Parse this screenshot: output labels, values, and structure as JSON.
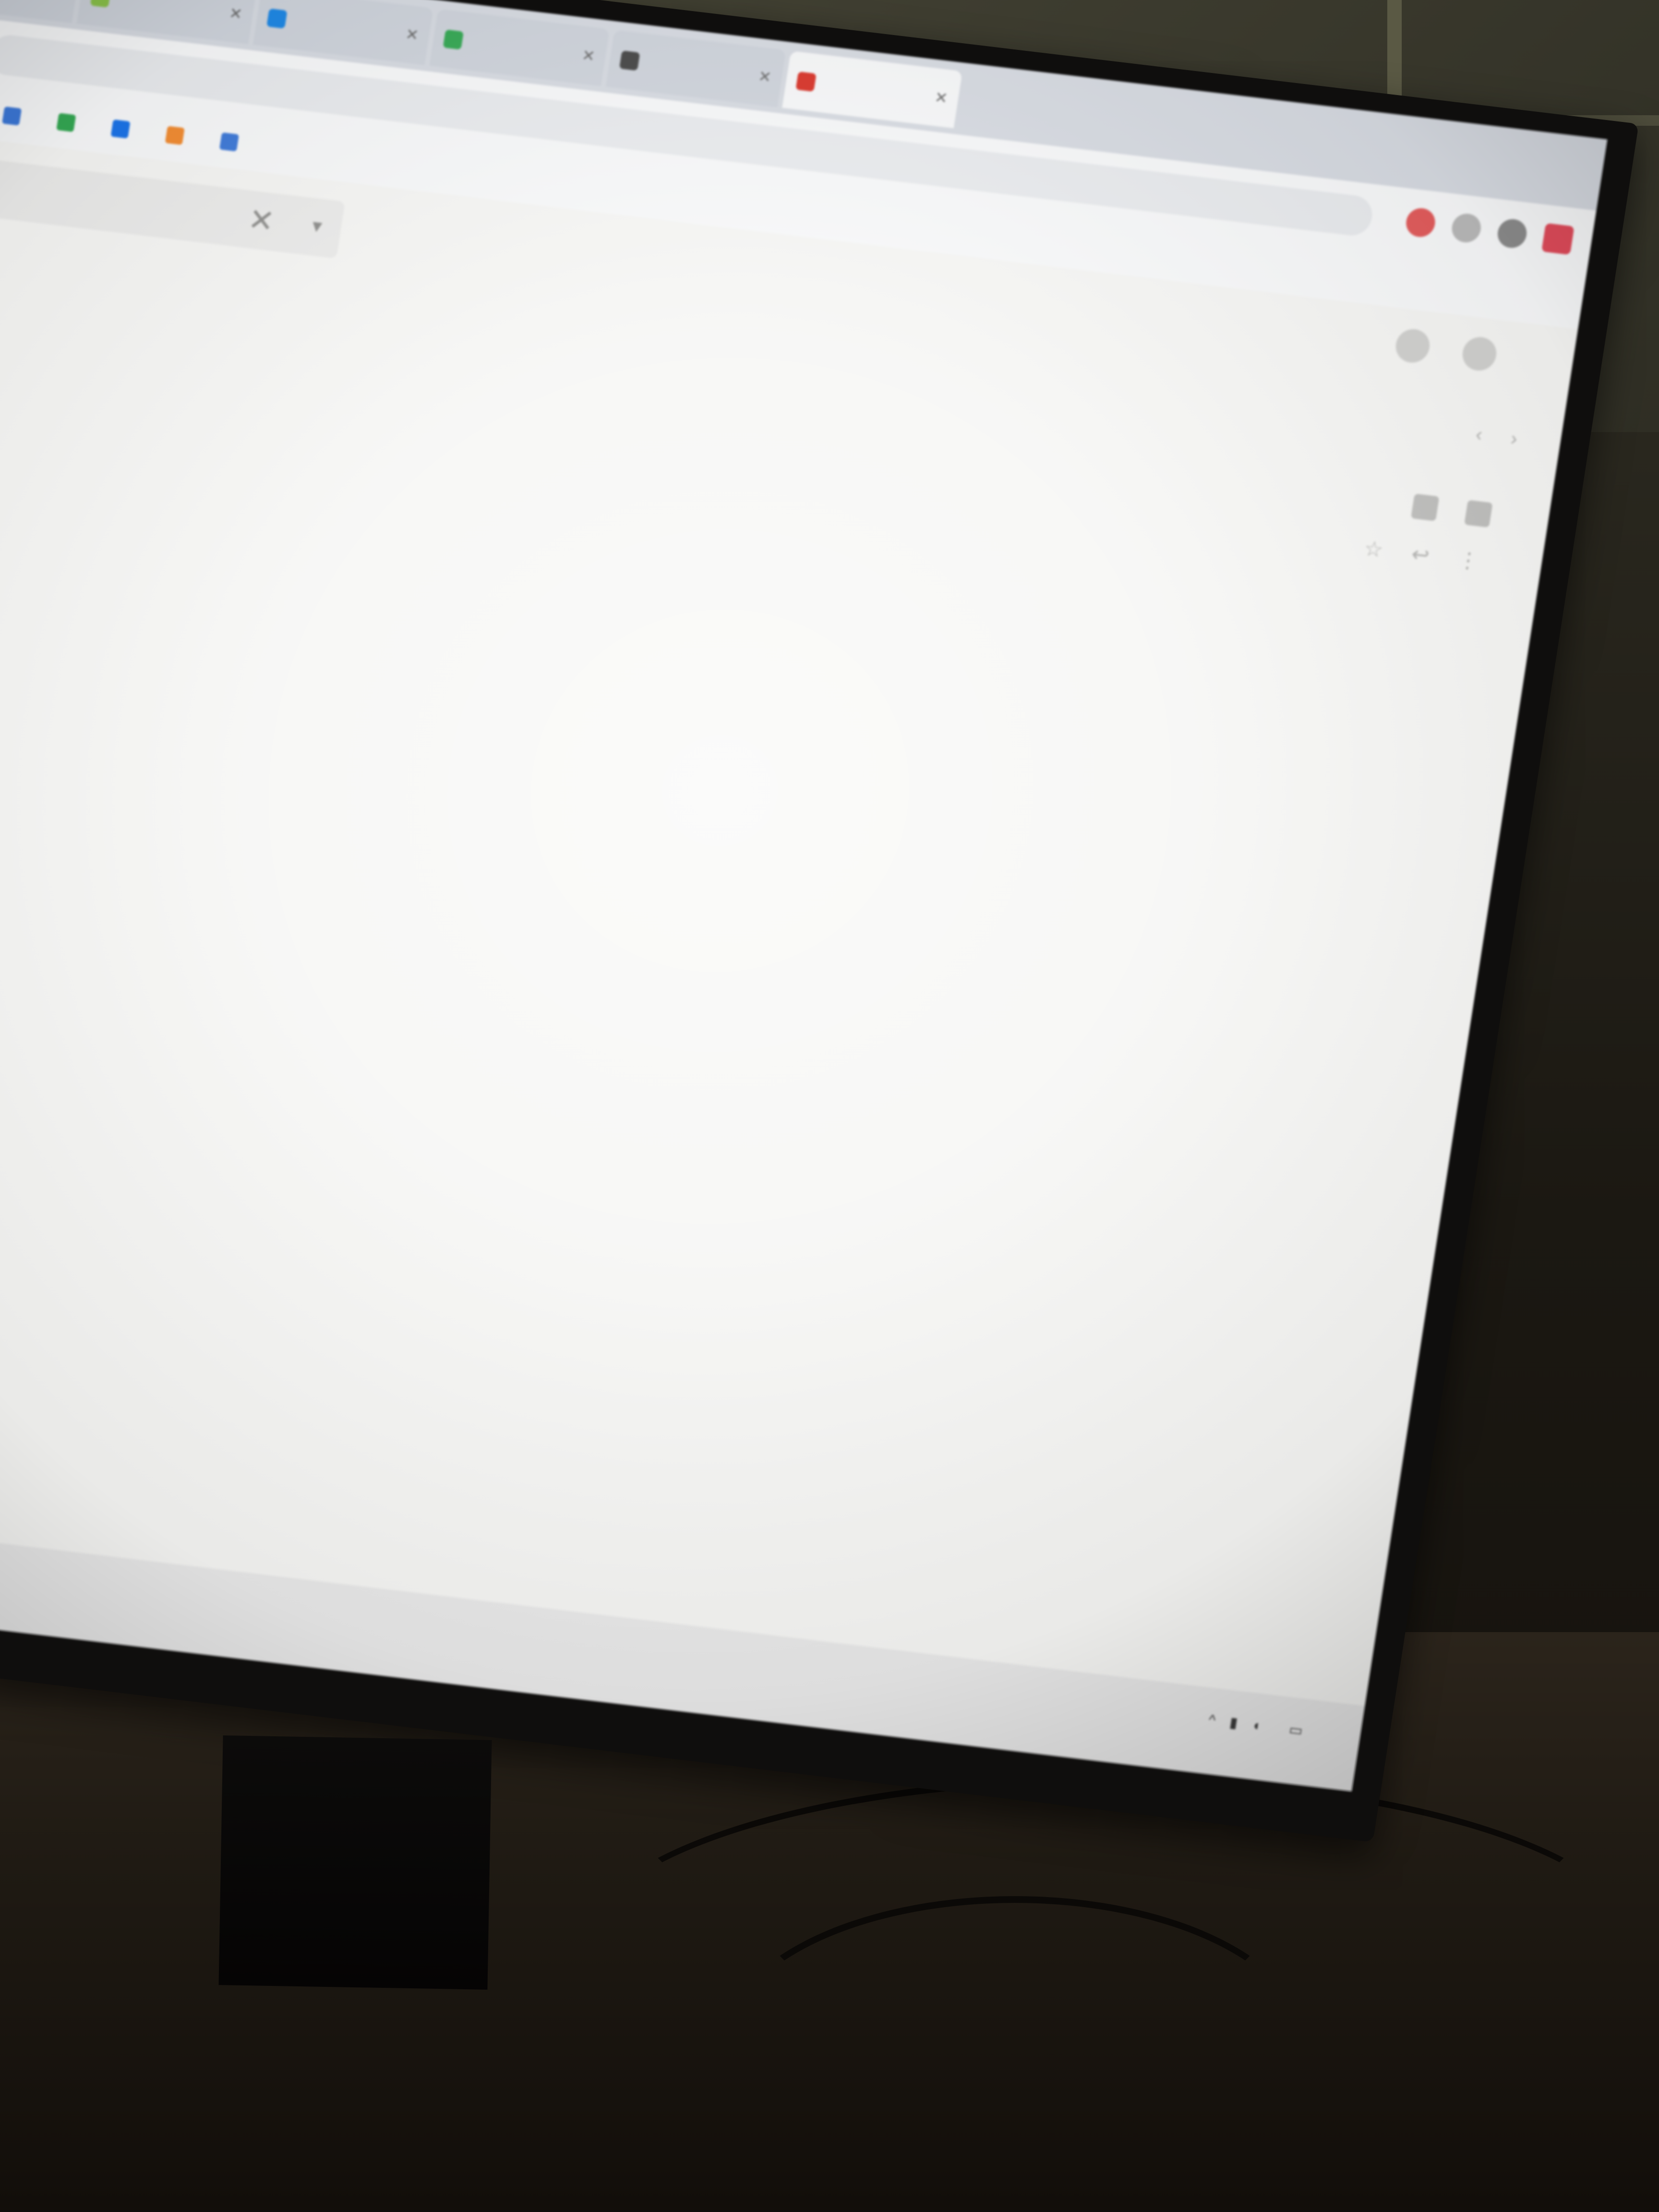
{
  "browser": {
    "tabs": [
      {
        "label": "",
        "favicon_color": "#3b82f6",
        "active": false
      },
      {
        "label": "",
        "favicon_color": "#8bc34a",
        "active": false
      },
      {
        "label": "",
        "favicon_color": "#1e88e5",
        "active": false
      },
      {
        "label": "",
        "favicon_color": "#34a853",
        "active": false
      },
      {
        "label": "",
        "favicon_color": "#444444",
        "active": false
      },
      {
        "label": "",
        "favicon_color": "#d93025",
        "active": true
      }
    ],
    "address": "",
    "bookmarks": [
      {
        "label": "",
        "icon_color": "#f28b30"
      },
      {
        "label": "",
        "icon_color": "#f28b30"
      },
      {
        "label": "",
        "icon_color": "#3c78d8"
      },
      {
        "label": "",
        "icon_color": "#34a853"
      },
      {
        "label": "",
        "icon_color": "#1a73e8"
      },
      {
        "label": "",
        "icon_color": "#f28b30"
      },
      {
        "label": "",
        "icon_color": "#3c78d8"
      }
    ]
  },
  "mail": {
    "search_close": "✕",
    "search_dropdown": "▾",
    "pager": "",
    "pager_prev": "‹",
    "pager_next": "›",
    "message_meta": ""
  },
  "watermark": {
    "title": "",
    "subtitle": ""
  },
  "taskbar": {
    "apps": [
      {
        "name": "blue-app-icon",
        "color": "#1a73e8"
      },
      {
        "name": "orange-app-icon",
        "color": "#f28b30"
      },
      {
        "name": "green-app-icon",
        "color": "#2ecc71"
      }
    ],
    "clock_time": "",
    "clock_date": ""
  },
  "colors": {
    "screen_bg": "#f2f1ee",
    "tabstrip": "#d7dbe2",
    "accent_red": "#d93025",
    "accent_blue": "#1a73e8"
  }
}
